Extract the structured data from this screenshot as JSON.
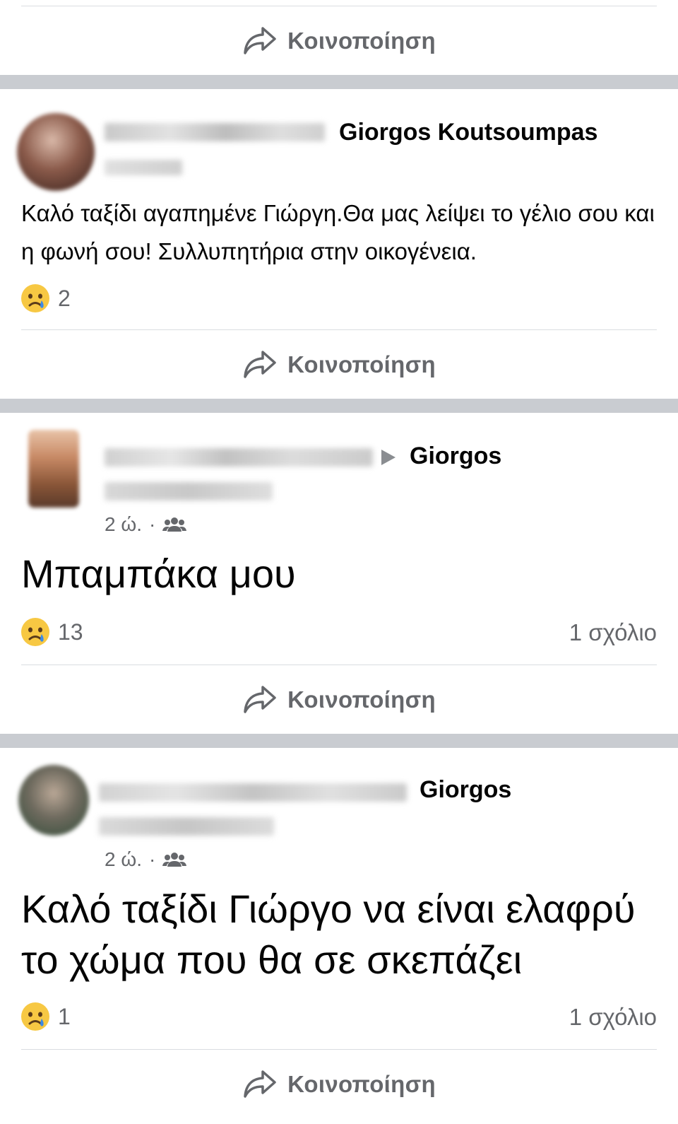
{
  "share_label": "Κοινοποίηση",
  "icons": {
    "share": "share-arrow-icon",
    "reaction": "sad-crying-face-icon",
    "audience": "friends-icon",
    "target": "arrow-right-icon"
  },
  "colors": {
    "separator": "#c9ccd1",
    "muted_text": "#65676b",
    "emoji_face": "#f7c843",
    "tear": "#3d8ae5"
  },
  "posts": [
    {
      "author": "Giorgos Koutsoumpas",
      "text": "Καλό ταξίδι αγαπημένε Γιώργη.Θα μας λείψει το γέλιο σου και η φωνή σου! Συλλυπητήρια στην οικογένεια.",
      "reaction_count": "2"
    },
    {
      "author": "Giorgos",
      "time": "2 ώ.",
      "separator": "·",
      "text": "Μπαμπάκα μου",
      "reaction_count": "13",
      "comments": "1 σχόλιο"
    },
    {
      "author": "Giorgos",
      "time": "2 ώ.",
      "separator": "·",
      "text": "Καλό ταξίδι Γιώργο να είναι ελαφρύ το χώμα που θα σε σκεπάζει",
      "reaction_count": "1",
      "comments": "1 σχόλιο"
    }
  ]
}
